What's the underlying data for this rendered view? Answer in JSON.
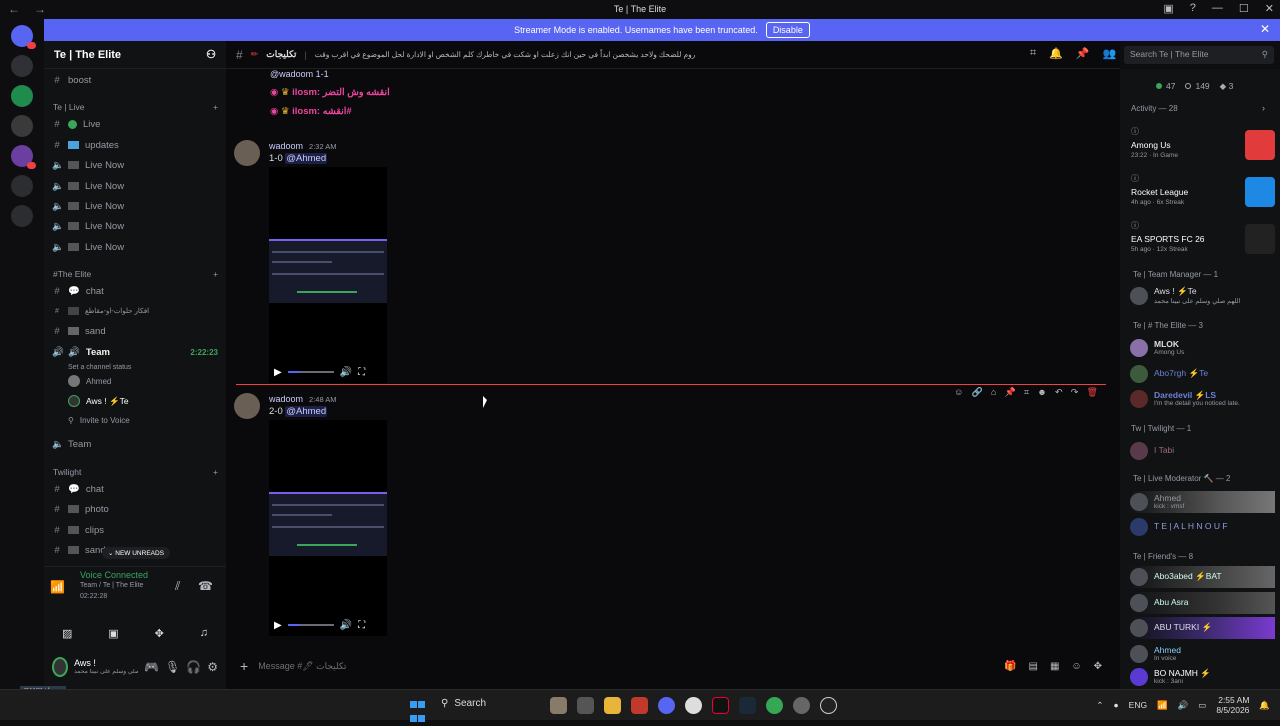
{
  "window": {
    "title": "Te | The Elite",
    "nav_back": "←",
    "nav_forward": "→",
    "controls": [
      "▣",
      "?",
      "—",
      "☐",
      "✕"
    ]
  },
  "banner": {
    "text": "Streamer Mode is enabled. Usernames have been truncated.",
    "button": "Disable",
    "close": "✕"
  },
  "server": {
    "name": "Te | The Elite"
  },
  "channel_header": {
    "name": "تكليجات",
    "topic": "روم للضحك ولاحد يشخصن ابداً في حين انك زعلت او شكت في خاطرك كلم الشخص او الادارة لحل الموضوع في اقرب وقت"
  },
  "search": {
    "placeholder": "Search Te | The Elite"
  },
  "channels": {
    "top": [
      {
        "name": "boost"
      }
    ],
    "live_category": "Te | Live",
    "live": [
      "Live",
      "updates",
      "Live Now",
      "Live Now",
      "Live Now",
      "Live Now",
      "Live Now"
    ],
    "elite_category": "#The Elite",
    "elite": [
      "chat",
      "افكار حلوات-او-مقاطع",
      "sand"
    ],
    "team": {
      "name": "Team",
      "time": "2:22:23",
      "status": "Set a channel status"
    },
    "team_members": [
      "Ahmed",
      "Aws ! ⚡Te"
    ],
    "invite": "Invite to Voice",
    "team2": "Team",
    "twilight_category": "Twilight",
    "twilight": [
      "chat",
      "photo",
      "clips",
      "sand"
    ],
    "new_unreads": "NEW UNREADS"
  },
  "voice": {
    "status": "Voice Connected",
    "location": "Team / Te | The Elite",
    "duration": "02:22:28"
  },
  "user": {
    "name": "Aws !",
    "status": "اللهم صلي وسلم على نبينا محمد"
  },
  "taskbar_badge": "meerra : زوهرا",
  "messages": [
    {
      "quote_head": "@wadoom 1-1",
      "quotes": [
        "ilosm: انقشه وش التضر",
        "ilosm: انقشه#"
      ]
    },
    {
      "author": "wadoom",
      "time": "2:32 AM",
      "text_prefix": "1-0 ",
      "mention": "@Ahmed"
    },
    {
      "author": "wadoom",
      "time": "2:48 AM",
      "text_prefix": "2-0 ",
      "mention": "@Ahmed"
    }
  ],
  "composer": {
    "placeholder": "Message #🖊 تكليجات"
  },
  "members_stats": {
    "online": "47",
    "idle": "149",
    "other": "3"
  },
  "activity": {
    "header": "Activity — 28",
    "items": [
      {
        "game": "Among Us",
        "sub": "23:22 · In Game",
        "color": "#e23b3b"
      },
      {
        "game": "Rocket League",
        "sub": "4h ago · 6x Streak",
        "color": "#1e88e5"
      },
      {
        "game": "EA SPORTS FC 26",
        "sub": "5h ago · 12x Streak",
        "color": "#222222"
      }
    ]
  },
  "member_groups": [
    {
      "title": "Te | Team Manager — 1",
      "members": [
        {
          "name": "Aws ! ⚡Te",
          "sub": "اللهم صلي وسلم على نبينا محمد"
        }
      ]
    },
    {
      "title": "Te | # The Elite — 3",
      "members": [
        {
          "name": "MLOK",
          "sub": "Among Us"
        },
        {
          "name": "Abo7rgh ⚡Te",
          "sub": ""
        },
        {
          "name": "Daredevil ⚡LS",
          "sub": "I'm the detail you noticed late."
        }
      ]
    },
    {
      "title": "Tw | Twilight — 1",
      "members": [
        {
          "name": "I Tabi",
          "sub": ""
        }
      ]
    },
    {
      "title": "Te | Live Moderator 🔨 — 2",
      "members": [
        {
          "name": "Ahmed",
          "sub": "kick : vmsf"
        },
        {
          "name": "T E | A L H N O U F",
          "sub": ""
        }
      ]
    },
    {
      "title": "Te | Friend's — 8",
      "members": [
        {
          "name": "Abo3abed ⚡BAT",
          "sub": ""
        },
        {
          "name": "Abu Asra",
          "sub": ""
        },
        {
          "name": "ABU TURKI ⚡",
          "sub": ""
        },
        {
          "name": "Ahmed",
          "sub": "In voice"
        },
        {
          "name": "BO NAJMH ⚡",
          "sub": "kick : 3ani"
        }
      ]
    }
  ],
  "taskbar": {
    "search": "Search",
    "lang": "ENG",
    "time": "2:55 AM",
    "date": "8/5/2026"
  }
}
